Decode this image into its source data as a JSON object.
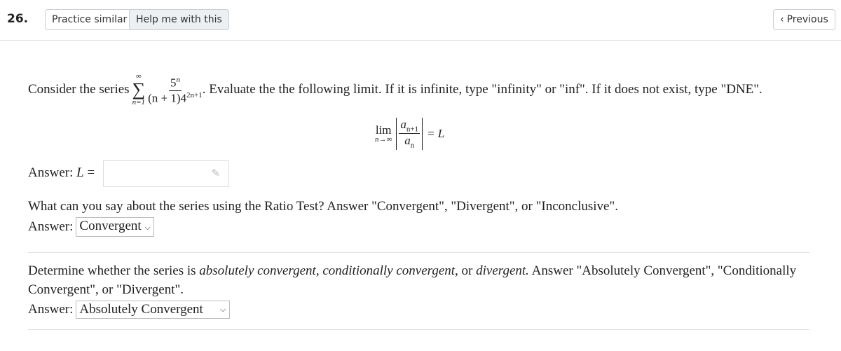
{
  "header": {
    "number": "26.",
    "practice_label": "Practice similar",
    "help_label": "Help me with this",
    "previous_label": "Previous"
  },
  "question": {
    "intro": "Consider the series",
    "sum_upper": "∞",
    "sum_lower": "n=1",
    "numerator": "5",
    "numerator_exp": "n",
    "denominator": "(n + 1)4",
    "denominator_exp": "2n+1",
    "instruction": ". Evaluate the the following limit. If it is infinite, type \"infinity\" or \"inf\". If it does not exist, type \"DNE\".",
    "limit": {
      "lim": "lim",
      "sub": "n→∞",
      "num": "a",
      "num_sub": "n+1",
      "den": "a",
      "den_sub": "n",
      "rhs": "= L"
    }
  },
  "answer1": {
    "label": "Answer: ",
    "var": "L",
    "eq": " =",
    "value": ""
  },
  "ratio": {
    "question": "What can you say about the series using the Ratio Test? Answer \"Convergent\", \"Divergent\", or \"Inconclusive\".",
    "label": "Answer:",
    "selected": "Convergent"
  },
  "absolute": {
    "line1_a": "Determine whether the series is ",
    "em1": "absolutely convergent, conditionally convergent,",
    "line1_b": " or ",
    "em2": "divergent.",
    "line1_c": " Answer \"Absolutely Convergent\", \"Conditionally",
    "line2": "Convergent\", or \"Divergent\".",
    "label": "Answer:",
    "selected": "Absolutely Convergent"
  }
}
